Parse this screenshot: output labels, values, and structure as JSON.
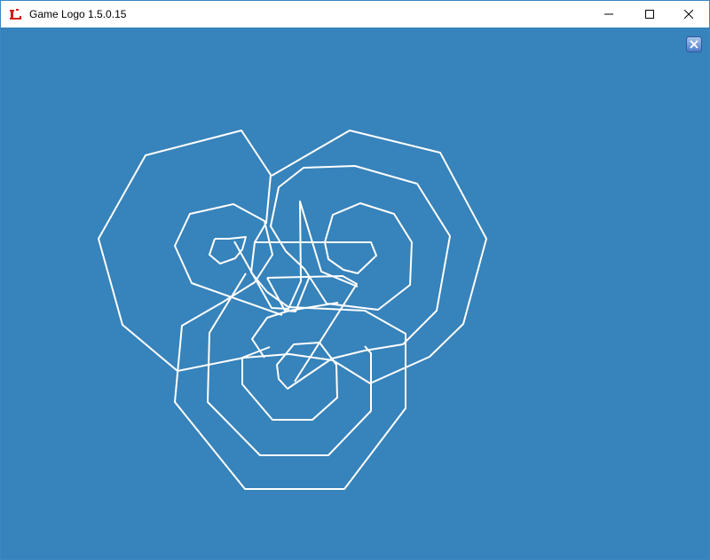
{
  "window": {
    "title": "Game Logo 1.5.0.15",
    "app_icon": "red-game-logo-icon",
    "controls": {
      "minimize_icon": "minimize-icon",
      "maximize_icon": "maximize-icon",
      "close_icon": "close-icon"
    }
  },
  "canvas": {
    "background_color": "#3783bb",
    "stroke_color": "#ffffff",
    "overlay_button_icon": "blue-close-icon"
  }
}
